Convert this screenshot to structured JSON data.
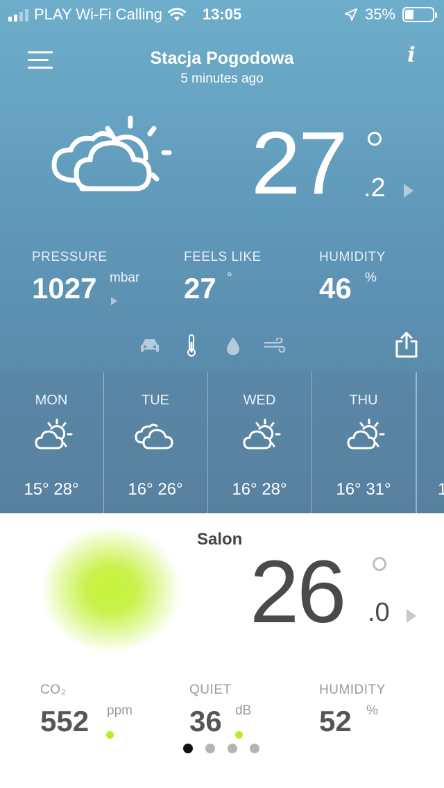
{
  "status_bar": {
    "carrier": "PLAY Wi-Fi Calling",
    "time": "13:05",
    "battery": "35%",
    "battery_level": 0.35,
    "icons": [
      "signal-icon",
      "wifi-icon",
      "location-arrow-icon",
      "battery-icon"
    ]
  },
  "header": {
    "title": "Stacja Pogodowa",
    "subtitle": "5 minutes ago",
    "left_icon": "menu-icon",
    "right_icon": "info-icon",
    "info_glyph": "i"
  },
  "outdoor": {
    "weather_icon": "partly-sunny-icon",
    "temp_int": "27",
    "temp_dec": ".2",
    "metrics": [
      {
        "label": "PRESSURE",
        "value": "1027",
        "unit": "mbar"
      },
      {
        "label": "FEELS LIKE",
        "value": "27",
        "unit": "°"
      },
      {
        "label": "HUMIDITY",
        "value": "46",
        "unit": "%"
      }
    ],
    "modes": [
      "car-icon",
      "thermometer-icon",
      "drop-icon",
      "wind-icon"
    ],
    "share_icon": "share-icon"
  },
  "forecast": [
    {
      "day": "MON",
      "icon": "partly-sunny-icon",
      "temps": "15°  28°"
    },
    {
      "day": "TUE",
      "icon": "cloud-icon",
      "temps": "16°  26°"
    },
    {
      "day": "WED",
      "icon": "partly-sunny-icon",
      "temps": "16°  28°"
    },
    {
      "day": "THU",
      "icon": "partly-sunny-icon",
      "temps": "16°  31°"
    },
    {
      "day": "",
      "icon": "",
      "temps": "1"
    }
  ],
  "indoor": {
    "room": "Salon",
    "temp_int": "26",
    "temp_dec": ".0",
    "glow_color": "#c4f032",
    "metrics": [
      {
        "label": "CO₂",
        "value": "552",
        "unit": "ppm",
        "indicator": "#b4ee23"
      },
      {
        "label": "QUIET",
        "value": "36",
        "unit": "dB",
        "indicator": "#b4ee23"
      },
      {
        "label": "HUMIDITY",
        "value": "52",
        "unit": "%"
      }
    ]
  },
  "pager": {
    "count": 4,
    "active": 0
  },
  "colors": {
    "sky_top": "#6eaecb",
    "sky_bottom": "#557f9f",
    "indicator_green": "#b4ee23"
  }
}
